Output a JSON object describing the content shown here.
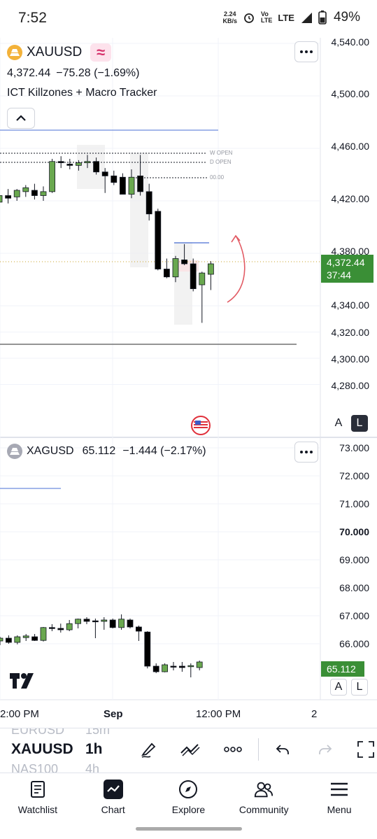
{
  "status_bar": {
    "time": "7:52",
    "speed_value": "2.24",
    "speed_unit": "KB/s",
    "network": "LTE",
    "battery": "49%"
  },
  "top_pane": {
    "symbol": "XAUUSD",
    "last_price": "4,372.44",
    "change": "−75.28 (−1.69%)",
    "indicator_name": "ICT Killzones + Macro Tracker",
    "level_labels": [
      "W OPEN",
      "D OPEN",
      "00.00"
    ],
    "price_axis": [
      "4,540.00",
      "4,500.00",
      "4,460.00",
      "4,420.00",
      "4,380.00",
      "4,340.00",
      "4,320.00",
      "4,300.00",
      "4,280.00"
    ],
    "price_tag": "4,372.44",
    "countdown": "37:44",
    "scale_buttons": [
      "A",
      "L"
    ],
    "candles": [
      {
        "o": 4419,
        "h": 4428,
        "l": 4412,
        "c": 4424
      },
      {
        "o": 4424,
        "h": 4429,
        "l": 4418,
        "c": 4422
      },
      {
        "o": 4423,
        "h": 4429,
        "l": 4420,
        "c": 4428
      },
      {
        "o": 4427,
        "h": 4432,
        "l": 4423,
        "c": 4430
      },
      {
        "o": 4428,
        "h": 4433,
        "l": 4421,
        "c": 4424
      },
      {
        "o": 4424,
        "h": 4431,
        "l": 4420,
        "c": 4427
      },
      {
        "o": 4427,
        "h": 4452,
        "l": 4426,
        "c": 4450
      },
      {
        "o": 4450,
        "h": 4454,
        "l": 4445,
        "c": 4449
      },
      {
        "o": 4448,
        "h": 4452,
        "l": 4444,
        "c": 4447
      },
      {
        "o": 4447,
        "h": 4451,
        "l": 4443,
        "c": 4449
      },
      {
        "o": 4449,
        "h": 4455,
        "l": 4445,
        "c": 4450
      },
      {
        "o": 4450,
        "h": 4453,
        "l": 4440,
        "c": 4442
      },
      {
        "o": 4442,
        "h": 4445,
        "l": 4426,
        "c": 4439
      },
      {
        "o": 4439,
        "h": 4443,
        "l": 4432,
        "c": 4434
      },
      {
        "o": 4438,
        "h": 4441,
        "l": 4425,
        "c": 4425
      },
      {
        "o": 4425,
        "h": 4444,
        "l": 4422,
        "c": 4438
      },
      {
        "o": 4439,
        "h": 4455,
        "l": 4424,
        "c": 4427
      },
      {
        "o": 4427,
        "h": 4433,
        "l": 4405,
        "c": 4410
      },
      {
        "o": 4412,
        "h": 4414,
        "l": 4367,
        "c": 4368
      },
      {
        "o": 4368,
        "h": 4376,
        "l": 4361,
        "c": 4362
      },
      {
        "o": 4362,
        "h": 4378,
        "l": 4358,
        "c": 4376
      },
      {
        "o": 4375,
        "h": 4387,
        "l": 4371,
        "c": 4372
      },
      {
        "o": 4372,
        "h": 4376,
        "l": 4351,
        "c": 4353
      },
      {
        "o": 4356,
        "h": 4366,
        "l": 4327,
        "c": 4365
      },
      {
        "o": 4364,
        "h": 4374,
        "l": 4352,
        "c": 4372
      }
    ]
  },
  "bottom_pane": {
    "symbol": "XAGUSD",
    "last_price": "65.112",
    "change": "−1.444 (−2.17%)",
    "price_axis": [
      "73.000",
      "72.000",
      "71.000",
      "70.000",
      "69.000",
      "68.000",
      "67.000",
      "66.000"
    ],
    "price_tag": "65.112",
    "scale_buttons": [
      "A",
      "L"
    ],
    "candles": [
      {
        "o": 66.1,
        "h": 66.25,
        "l": 65.95,
        "c": 66.2
      },
      {
        "o": 66.2,
        "h": 66.3,
        "l": 66.0,
        "c": 66.05
      },
      {
        "o": 66.05,
        "h": 66.3,
        "l": 65.98,
        "c": 66.25
      },
      {
        "o": 66.22,
        "h": 66.35,
        "l": 66.1,
        "c": 66.28
      },
      {
        "o": 66.25,
        "h": 66.35,
        "l": 66.1,
        "c": 66.12
      },
      {
        "o": 66.12,
        "h": 66.6,
        "l": 66.08,
        "c": 66.58
      },
      {
        "o": 66.58,
        "h": 66.7,
        "l": 66.45,
        "c": 66.55
      },
      {
        "o": 66.55,
        "h": 66.72,
        "l": 66.4,
        "c": 66.5
      },
      {
        "o": 66.5,
        "h": 66.85,
        "l": 66.45,
        "c": 66.72
      },
      {
        "o": 66.72,
        "h": 66.9,
        "l": 66.55,
        "c": 66.88
      },
      {
        "o": 66.88,
        "h": 66.95,
        "l": 66.7,
        "c": 66.8
      },
      {
        "o": 66.82,
        "h": 66.9,
        "l": 66.2,
        "c": 66.8
      },
      {
        "o": 66.8,
        "h": 66.95,
        "l": 66.5,
        "c": 66.85
      },
      {
        "o": 66.85,
        "h": 66.9,
        "l": 66.55,
        "c": 66.58
      },
      {
        "o": 66.58,
        "h": 67.05,
        "l": 66.5,
        "c": 66.88
      },
      {
        "o": 66.85,
        "h": 66.9,
        "l": 66.55,
        "c": 66.6
      },
      {
        "o": 66.6,
        "h": 66.65,
        "l": 66.1,
        "c": 66.45
      },
      {
        "o": 66.42,
        "h": 66.45,
        "l": 65.12,
        "c": 65.2
      },
      {
        "o": 65.2,
        "h": 65.3,
        "l": 64.95,
        "c": 65.0
      },
      {
        "o": 65.0,
        "h": 65.3,
        "l": 64.98,
        "c": 65.25
      },
      {
        "o": 65.2,
        "h": 65.35,
        "l": 65.05,
        "c": 65.18
      },
      {
        "o": 65.2,
        "h": 65.35,
        "l": 65.0,
        "c": 65.15
      },
      {
        "o": 65.18,
        "h": 65.3,
        "l": 64.8,
        "c": 65.22
      },
      {
        "o": 65.15,
        "h": 65.4,
        "l": 65.05,
        "c": 65.35
      }
    ]
  },
  "time_axis": [
    "2:00 PM",
    "Sep",
    "12:00 PM",
    "2"
  ],
  "toolbar": {
    "picker_above": "EURUSD",
    "picker_above_tf": "15m",
    "symbol": "XAUUSD",
    "timeframe": "1h",
    "picker_below": "NAS100",
    "picker_below_tf": "4h"
  },
  "bottom_nav": [
    {
      "label": "Watchlist",
      "icon": "watchlist-icon"
    },
    {
      "label": "Chart",
      "icon": "chart-icon"
    },
    {
      "label": "Explore",
      "icon": "compass-icon"
    },
    {
      "label": "Community",
      "icon": "community-icon"
    },
    {
      "label": "Menu",
      "icon": "menu-icon"
    }
  ],
  "colors": {
    "bull": "#6aa84f",
    "bear": "#000000",
    "price_tag": "#3a8f36",
    "accent_badge": "#d6336c",
    "line_blue": "#4a6fd4",
    "arrow": "#e25b64"
  }
}
